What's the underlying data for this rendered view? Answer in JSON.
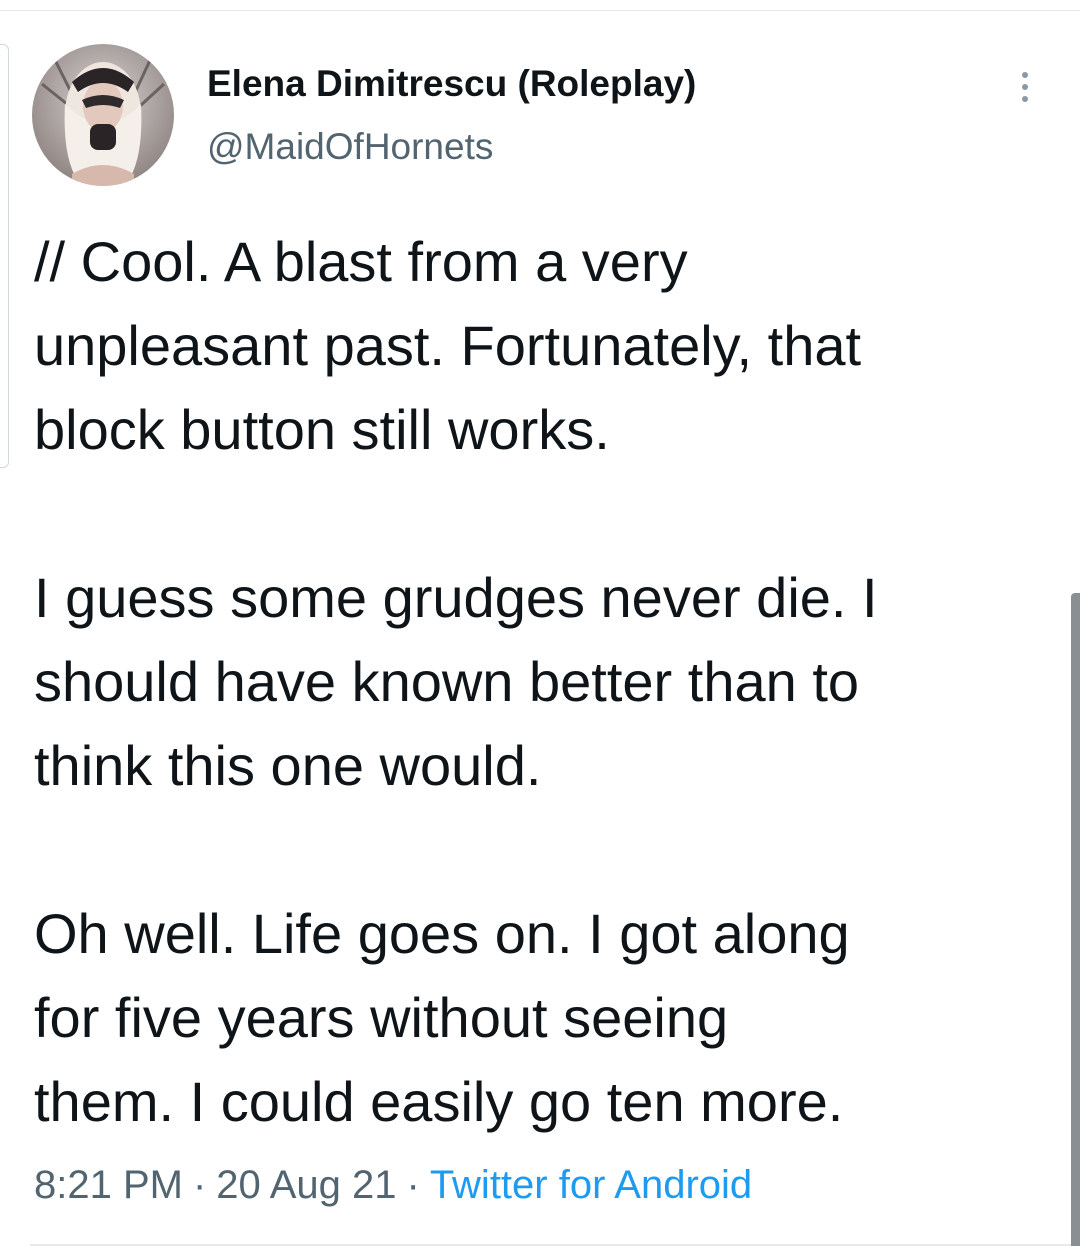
{
  "tweet": {
    "author": {
      "display_name": "Elena Dimitrescu (Roleplay)",
      "handle": "@MaidOfHornets"
    },
    "paragraphs": [
      "// Cool. A blast from a very\nunpleasant past. Fortunately, that\nblock button still works.",
      "I guess some grudges never die. I\nshould have known better than to\nthink this one would.",
      "Oh well. Life goes on. I got along\nfor five years without seeing\nthem. I could easily go ten more."
    ],
    "time": "8:21 PM",
    "separator": "·",
    "date": "20 Aug 21",
    "source": "Twitter for Android"
  },
  "icons": {
    "more": "more-vertical-icon"
  },
  "colors": {
    "text": "#0f1419",
    "secondary": "#536471",
    "link": "#1d9bf0"
  }
}
